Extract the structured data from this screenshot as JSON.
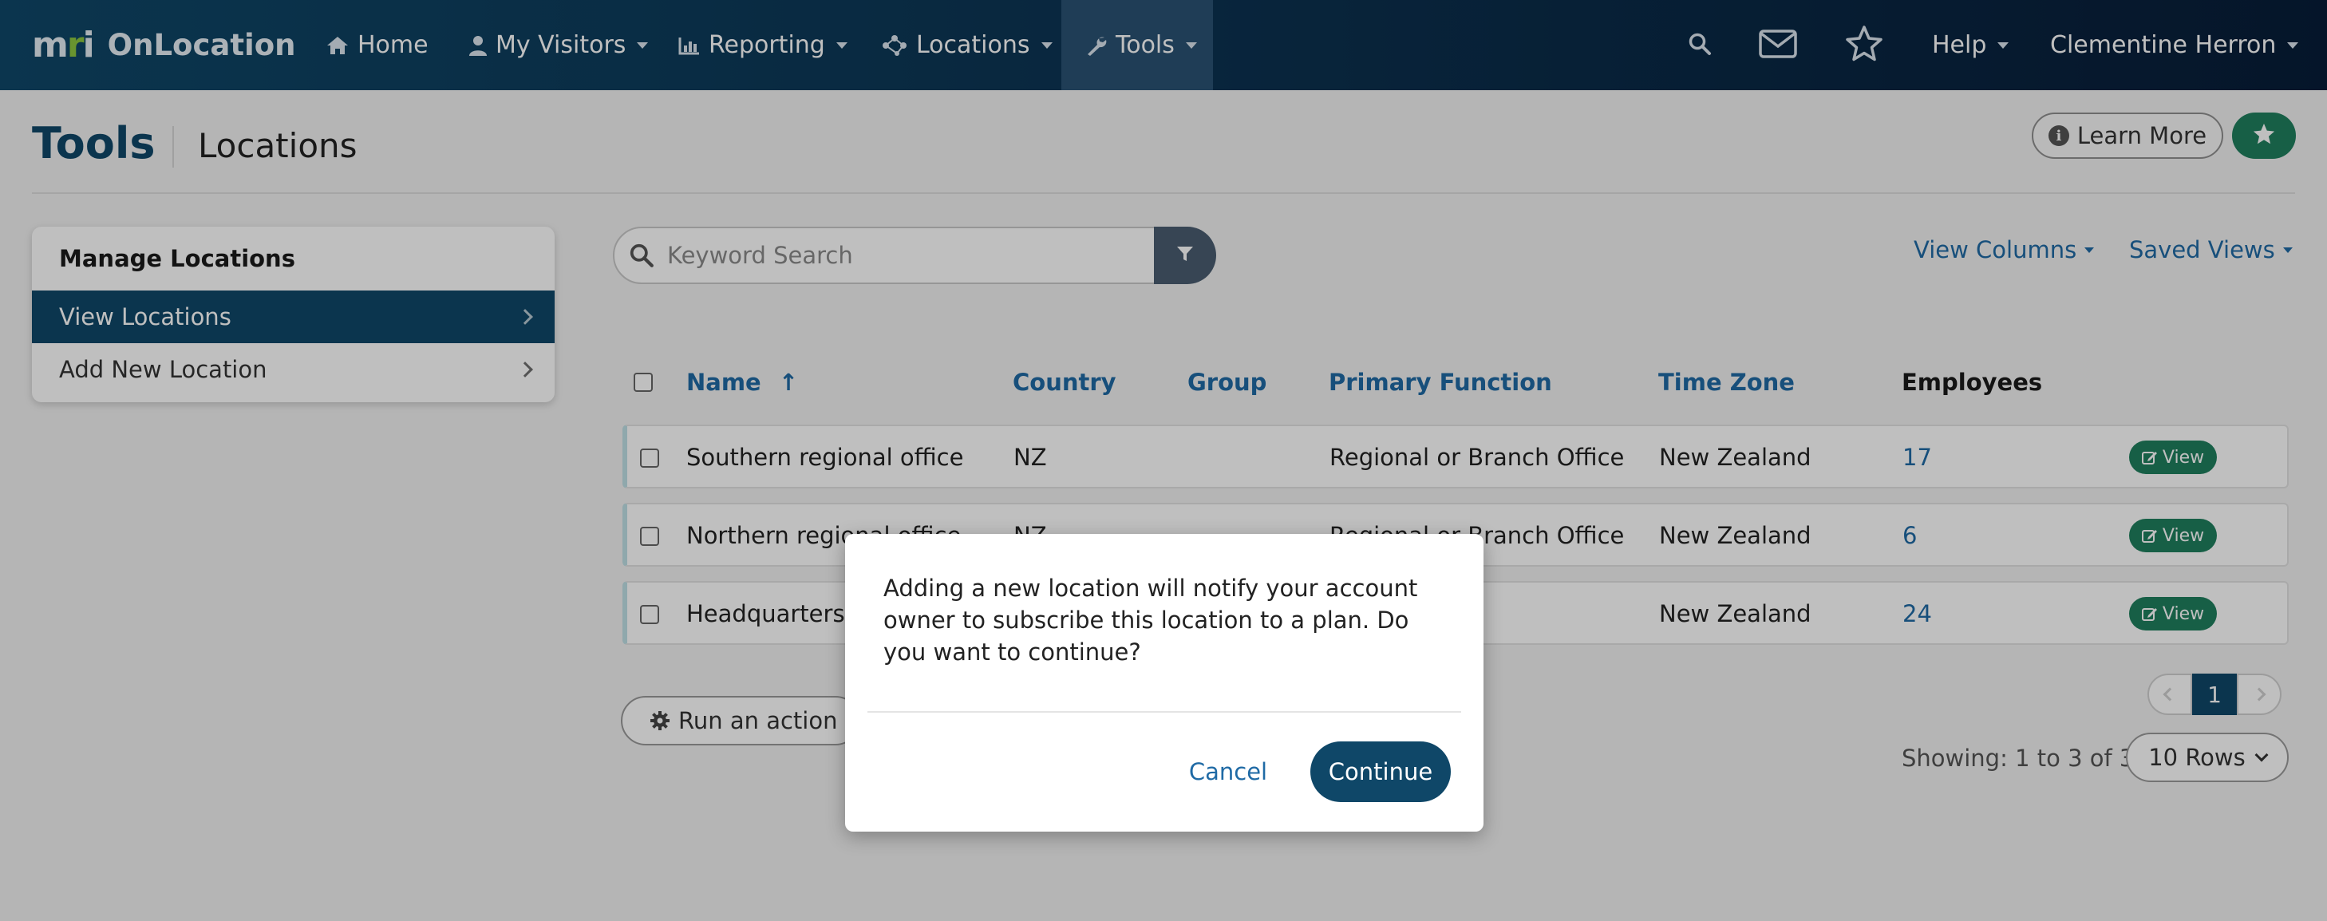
{
  "app": {
    "logo_text": "mri",
    "name": "OnLocation"
  },
  "nav": {
    "home": "Home",
    "my_visitors": "My Visitors",
    "reporting": "Reporting",
    "locations": "Locations",
    "tools": "Tools",
    "help": "Help",
    "user": "Clementine Herron"
  },
  "header": {
    "title": "Tools",
    "subtitle": "Locations",
    "learn_more": "Learn More"
  },
  "sidebar": {
    "heading": "Manage Locations",
    "items": [
      {
        "label": "View Locations",
        "active": true
      },
      {
        "label": "Add New Location",
        "active": false
      }
    ]
  },
  "search": {
    "placeholder": "Keyword Search"
  },
  "toolbar": {
    "view_columns": "View Columns",
    "saved_views": "Saved Views"
  },
  "table": {
    "headers": {
      "name": "Name",
      "sort_indicator": "↑",
      "country": "Country",
      "group": "Group",
      "primary_function": "Primary Function",
      "time_zone": "Time Zone",
      "employees": "Employees"
    },
    "rows": [
      {
        "name": "Southern regional office",
        "country": "NZ",
        "group": "",
        "primary_function": "Regional or Branch Office",
        "time_zone": "New Zealand",
        "employees": "17",
        "action": "View"
      },
      {
        "name": "Northern regional office",
        "country": "NZ",
        "group": "",
        "primary_function": "Regional or Branch Office",
        "time_zone": "New Zealand",
        "employees": "6",
        "action": "View"
      },
      {
        "name": "Headquarters",
        "country": "",
        "group": "",
        "primary_function": "",
        "time_zone": "New Zealand",
        "employees": "24",
        "action": "View"
      }
    ]
  },
  "footer": {
    "run_action": "Run an action",
    "current_page": "1",
    "showing": "Showing: 1 to 3 of 3",
    "rows_per_page": "10 Rows"
  },
  "modal": {
    "message": "Adding a new location will notify your account owner to subscribe this location to a plan. Do you want to continue?",
    "cancel": "Cancel",
    "continue": "Continue"
  },
  "colors": {
    "brand_navy": "#0f4768",
    "accent_green": "#1f7f5e",
    "link_blue": "#1f6aa5",
    "logo_green": "#8dc63f"
  }
}
